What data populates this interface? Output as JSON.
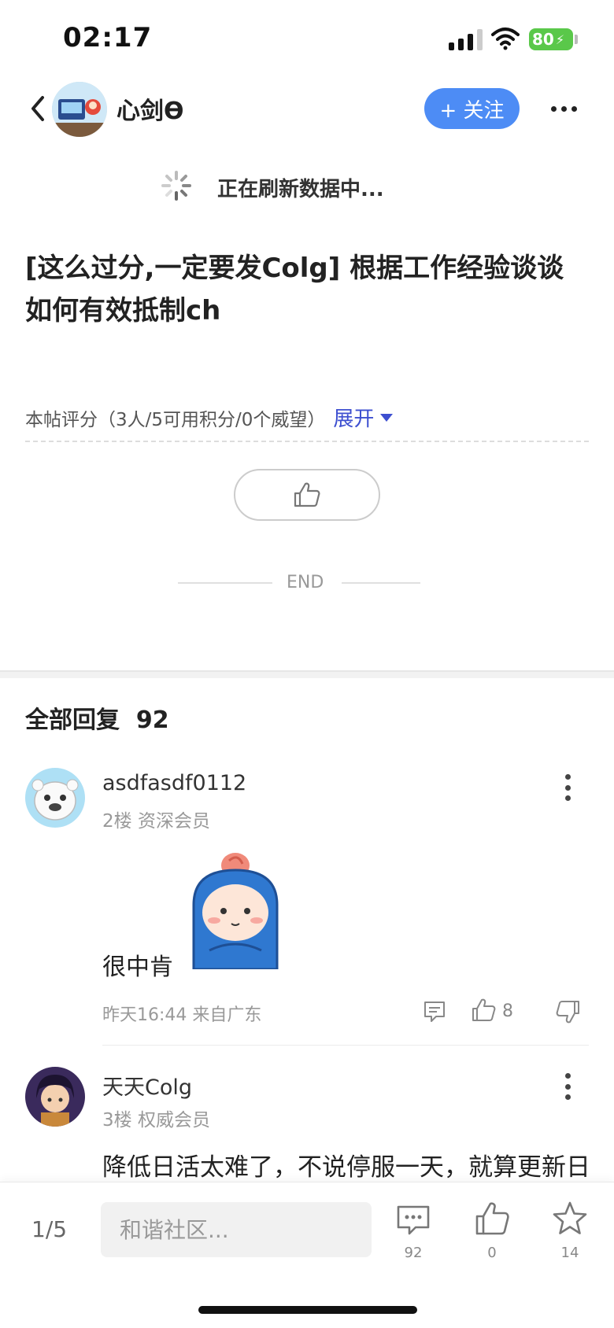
{
  "status_bar": {
    "time": "02:17",
    "battery": "80"
  },
  "header": {
    "username": "心剑ϴ",
    "follow_label": "+ 关注"
  },
  "refresh_text": "正在刷新数据中...",
  "post": {
    "title": "[这么过分,一定要发Colg] 根据工作经验谈谈如何有效抵制ch",
    "rating_text": "本帖评分（3人/5可用积分/0个威望）",
    "expand_label": "展开",
    "end_label": "END"
  },
  "replies": {
    "header": "全部回复",
    "count": "92",
    "items": [
      {
        "username": "asdfasdf0112",
        "meta": "2楼 资深会员",
        "text": "很中肯",
        "time_loc": "昨天16:44 来自广东",
        "likes": "8"
      },
      {
        "username": "天天Colg",
        "meta": "3楼 权威会员",
        "text": "降低日活太难了，不说停服一天，就算更新日"
      }
    ]
  },
  "bottom_bar": {
    "page": "1/5",
    "input_placeholder": "和谐社区...",
    "comment_count": "92",
    "like_count": "0",
    "fav_count": "14"
  },
  "colors": {
    "accent_blue": "#4d8cf5",
    "expand_blue": "#3d4fd0",
    "battery_green": "#5ac84a"
  }
}
